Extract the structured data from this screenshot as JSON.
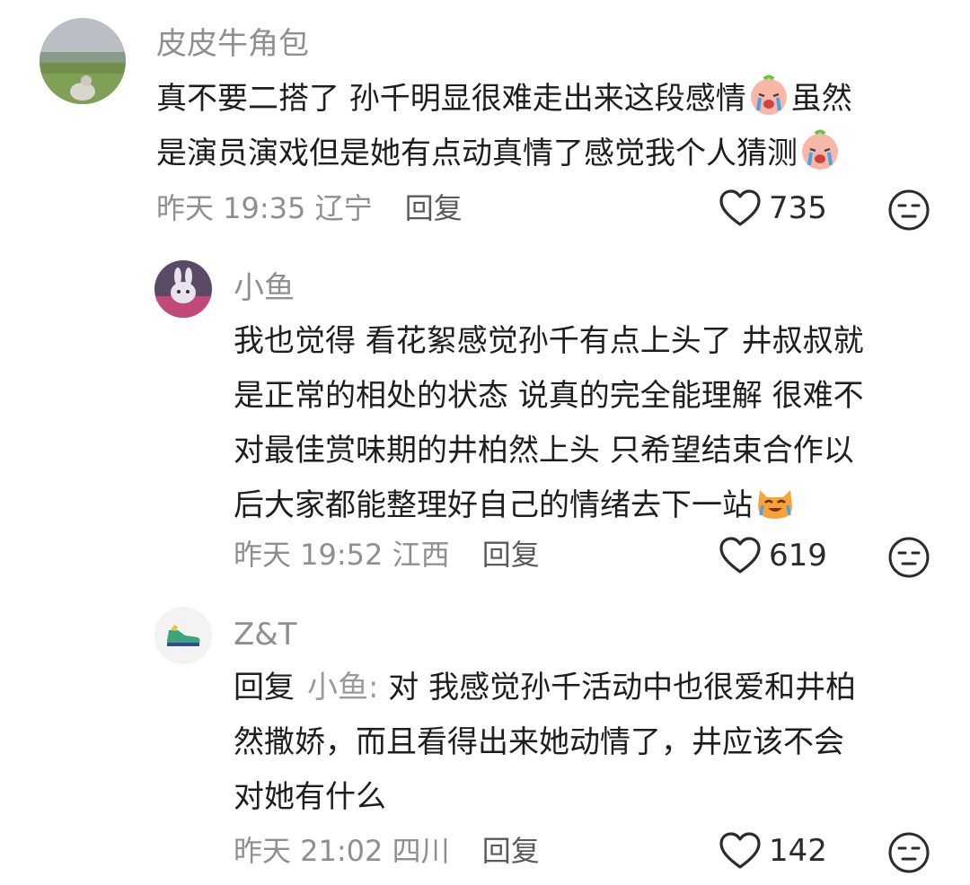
{
  "comments": [
    {
      "username": "皮皮牛角包",
      "lines": [
        "真不要二搭了 孙千明显很难走出来这段感情",
        "是演员演戏但是她有点动真情了感觉我个人猜测"
      ],
      "line1_after_emoji": "虽然",
      "time": "昨天 19:35",
      "location": "辽宁",
      "reply_label": "回复",
      "likes": "735",
      "avatar_icon": "landscape-avatar"
    },
    {
      "username": "小鱼",
      "lines": [
        "我也觉得 看花絮感觉孙千有点上头了 井叔叔就",
        "是正常的相处的状态 说真的完全能理解 很难不",
        "对最佳赏味期的井柏然上头 只希望结束合作以",
        "后大家都能整理好自己的情绪去下一站"
      ],
      "time": "昨天 19:52",
      "location": "江西",
      "reply_label": "回复",
      "likes": "619",
      "avatar_icon": "bunny-avatar"
    },
    {
      "username": "Z&T",
      "reply_prefix": "回复",
      "reply_target": "小鱼:",
      "lines": [
        "对 我感觉孙千活动中也很爱和井柏",
        "然撒娇，而且看得出来她动情了，井应该不会",
        "对她有什么"
      ],
      "time": "昨天 21:02",
      "location": "四川",
      "reply_label": "回复",
      "likes": "142",
      "avatar_icon": "sneaker-avatar"
    }
  ],
  "colors": {
    "muted": "#8f8f8f",
    "text": "#1e1e1e",
    "background": "#ffffff"
  },
  "icons": {
    "like": "heart-outline-icon",
    "dislike": "meh-face-icon",
    "emoji_crying": "crying-face-emoji",
    "emoji_cat": "crying-cat-emoji"
  }
}
